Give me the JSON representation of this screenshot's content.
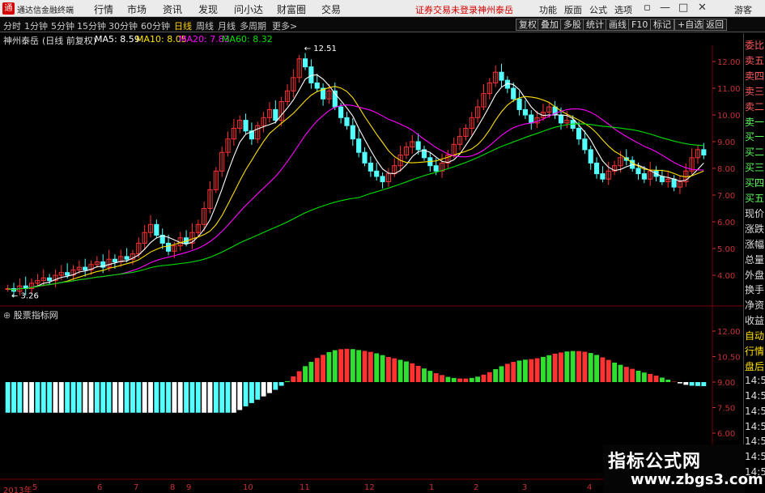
{
  "titlebar": {
    "logo": "通",
    "app_title": "通达信金融终端",
    "menus": [
      "行情",
      "市场",
      "资讯",
      "发现",
      "问小达",
      "财富圈",
      "交易"
    ],
    "status_red": "证券交易未登录",
    "stock_red": "神州泰岳",
    "right_buttons": [
      "功能",
      "版面",
      "公式",
      "选项"
    ],
    "guest": "游客",
    "win_controls": [
      "▫",
      "—",
      "□",
      "✕"
    ]
  },
  "toolbar": {
    "periods": [
      "分时",
      "1分钟",
      "5分钟",
      "15分钟",
      "30分钟",
      "60分钟",
      "日线",
      "周线",
      "月线",
      "多周期",
      "更多>"
    ],
    "active_period": "日线",
    "right_tools": [
      "复权",
      "叠加",
      "多股",
      "统计",
      "画线",
      "F10",
      "标记",
      "+自选",
      "返回"
    ]
  },
  "info": {
    "stock": "神州泰岳",
    "mode": "(日线 前复权)",
    "ma5": "MA5: 8.59",
    "ma10": "MA10: 8.05",
    "ma20": "MA20: 7.83",
    "ma60": "MA60: 8.32"
  },
  "colors": {
    "up": "#ff3232",
    "down": "#54ffff",
    "ma5": "#ffffff",
    "ma10": "#ffe000",
    "ma20": "#ff00ff",
    "ma60": "#00e000",
    "grid": "#7a0000"
  },
  "price_axis": [
    "12.00",
    "11.00",
    "10.00",
    "9.00",
    "8.00",
    "7.00",
    "6.00",
    "5.00",
    "4.00"
  ],
  "price_labels": {
    "high": "12.51",
    "low": "3.26"
  },
  "sub_indicator": {
    "label": "股票指标网",
    "axis": [
      "12.00",
      "10.50",
      "9.00",
      "7.50",
      "6.00"
    ]
  },
  "date_axis": [
    "2013年",
    "5",
    "6",
    "7",
    "8",
    "9",
    "10",
    "11",
    "12",
    "1",
    "2",
    "3",
    "4"
  ],
  "right_panel": {
    "items": [
      "委比",
      "卖五",
      "卖四",
      "卖三",
      "卖二",
      "卖一",
      "买一",
      "买二",
      "买三",
      "买四",
      "买五",
      "现价",
      "涨跌",
      "涨幅",
      "总量",
      "外盘",
      "换手",
      "净资",
      "收益",
      "自动",
      "行情",
      "盘后",
      "14:50",
      "14:50",
      "14:50",
      "14:50",
      "14:50",
      "14:50",
      "14:50"
    ]
  },
  "watermark": {
    "line1": "指标公式网",
    "line2": "www.zbgs3.com"
  },
  "chart_data": {
    "type": "candlestick",
    "note": "daily candles approximated",
    "closes": [
      3.5,
      3.4,
      3.6,
      3.5,
      3.7,
      3.8,
      3.9,
      3.8,
      4.0,
      4.1,
      4.0,
      4.2,
      4.3,
      4.2,
      4.4,
      4.5,
      4.3,
      4.6,
      4.5,
      4.7,
      4.6,
      4.8,
      5.2,
      5.6,
      5.9,
      5.5,
      5.2,
      4.9,
      5.1,
      5.4,
      5.2,
      5.6,
      5.9,
      6.5,
      7.2,
      7.9,
      8.6,
      9.1,
      9.5,
      9.8,
      9.4,
      9.1,
      9.6,
      9.9,
      10.2,
      9.8,
      10.5,
      10.9,
      11.4,
      12.1,
      11.8,
      11.2,
      11.0,
      10.6,
      10.9,
      10.3,
      9.9,
      9.6,
      9.1,
      8.6,
      8.2,
      7.9,
      7.7,
      7.5,
      7.8,
      8.1,
      8.5,
      8.8,
      9.0,
      8.7,
      8.4,
      8.1,
      7.9,
      8.2,
      8.5,
      8.9,
      9.2,
      9.5,
      9.9,
      10.3,
      10.8,
      11.2,
      11.6,
      11.3,
      11.0,
      10.6,
      10.2,
      10.0,
      9.7,
      9.9,
      10.1,
      10.3,
      10.0,
      9.7,
      9.8,
      9.5,
      9.1,
      8.7,
      8.2,
      7.8,
      7.6,
      7.9,
      8.1,
      8.4,
      8.3,
      8.0,
      7.8,
      7.6,
      7.9,
      7.7,
      7.5,
      7.6,
      7.3,
      7.5,
      7.9,
      8.4,
      8.7,
      8.5
    ]
  }
}
